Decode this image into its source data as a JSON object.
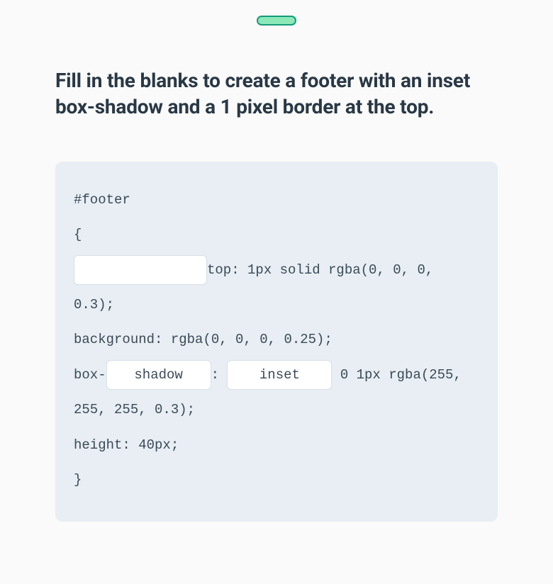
{
  "progress_percent": 100,
  "prompt": "Fill in the blanks to create a footer with an inset box-shadow and a 1 pixel border at the top.",
  "code": {
    "line1": "#footer",
    "line2": "{",
    "blank1_value": "",
    "after_blank1": "top: 1px solid rgba(0, 0, 0, 0.3);",
    "line4": "background: rgba(0, 0, 0, 0.25);",
    "line5_prefix": "box-",
    "blank2_value": "shadow",
    "line5_mid": ": ",
    "blank3_value": "inset",
    "line5_suffix": " 0 1px rgba(255, 255, 255, 0.3);",
    "line6": "height: 40px;",
    "line7": "}"
  }
}
